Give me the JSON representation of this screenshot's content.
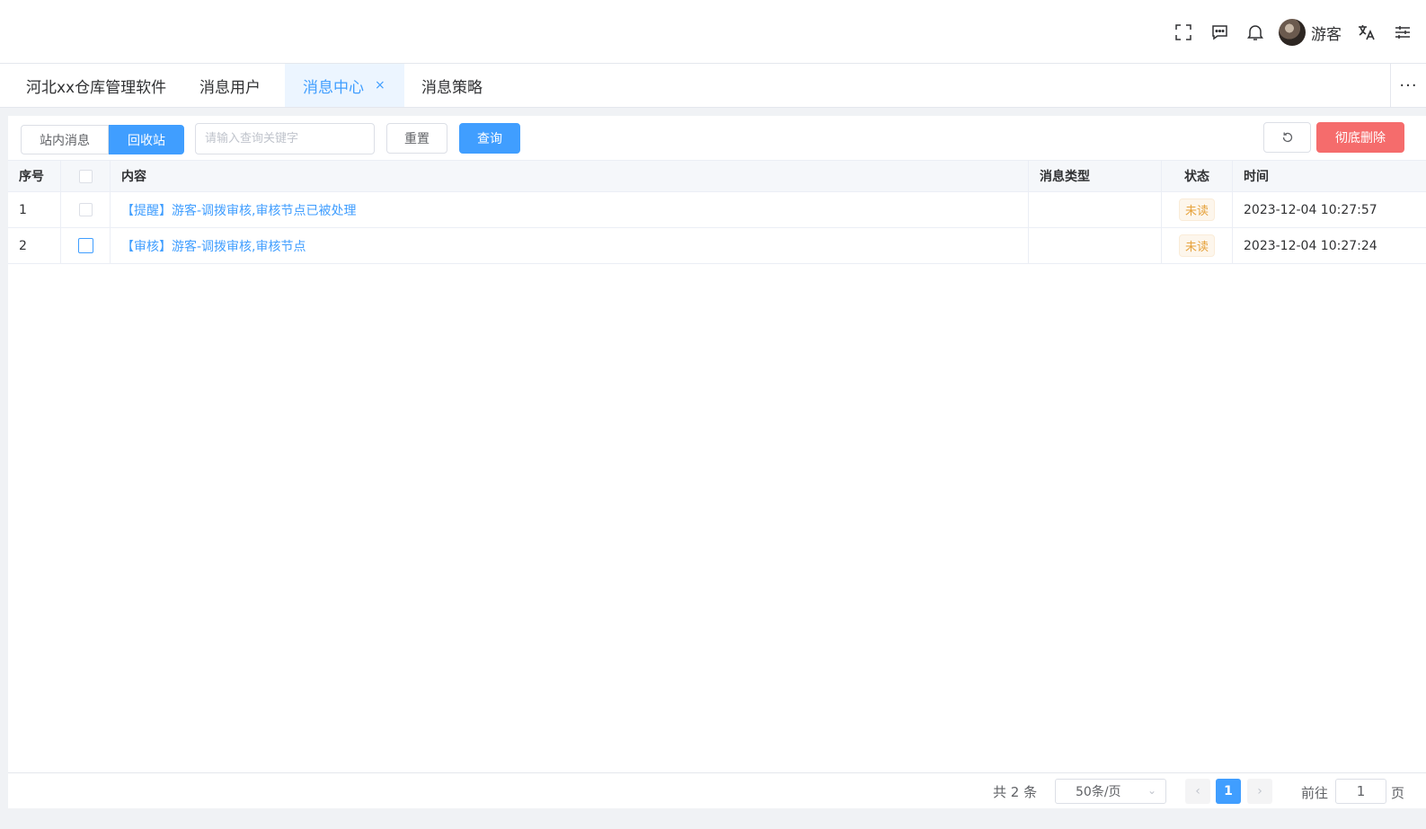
{
  "header": {
    "user_name": "游客",
    "icons": [
      "fullscreen-icon",
      "message-icon",
      "bell-icon",
      "translate-icon",
      "settings-sliders-icon"
    ]
  },
  "tabs": [
    {
      "label": "河北xx仓库管理软件",
      "active": false
    },
    {
      "label": "消息用户",
      "active": false
    },
    {
      "label": "消息中心",
      "active": true,
      "close": "×"
    },
    {
      "label": "消息策略",
      "active": false
    }
  ],
  "tabs_more": "···",
  "toolbar": {
    "seg_inbox": "站内消息",
    "seg_recycle": "回收站",
    "search_placeholder": "请输入查询关键字",
    "reset_label": "重置",
    "query_label": "查询",
    "delete_label": "彻底删除"
  },
  "table": {
    "headers": {
      "index": "序号",
      "content": "内容",
      "type": "消息类型",
      "status": "状态",
      "time": "时间"
    },
    "rows": [
      {
        "index": "1",
        "content": "【提醒】游客-调拨审核,审核节点已被处理",
        "type": "",
        "status": "未读",
        "time": "2023-12-04 10:27:57"
      },
      {
        "index": "2",
        "content": "【审核】游客-调拨审核,审核节点",
        "type": "",
        "status": "未读",
        "time": "2023-12-04 10:27:24"
      }
    ]
  },
  "pagination": {
    "total": "共 2 条",
    "page_size": "50条/页",
    "current_page": "1",
    "goto_label": "前往",
    "goto_value": "1",
    "goto_unit": "页"
  },
  "colors": {
    "primary": "#409eff",
    "danger": "#f56c6c",
    "warning": "#e6a23c"
  }
}
